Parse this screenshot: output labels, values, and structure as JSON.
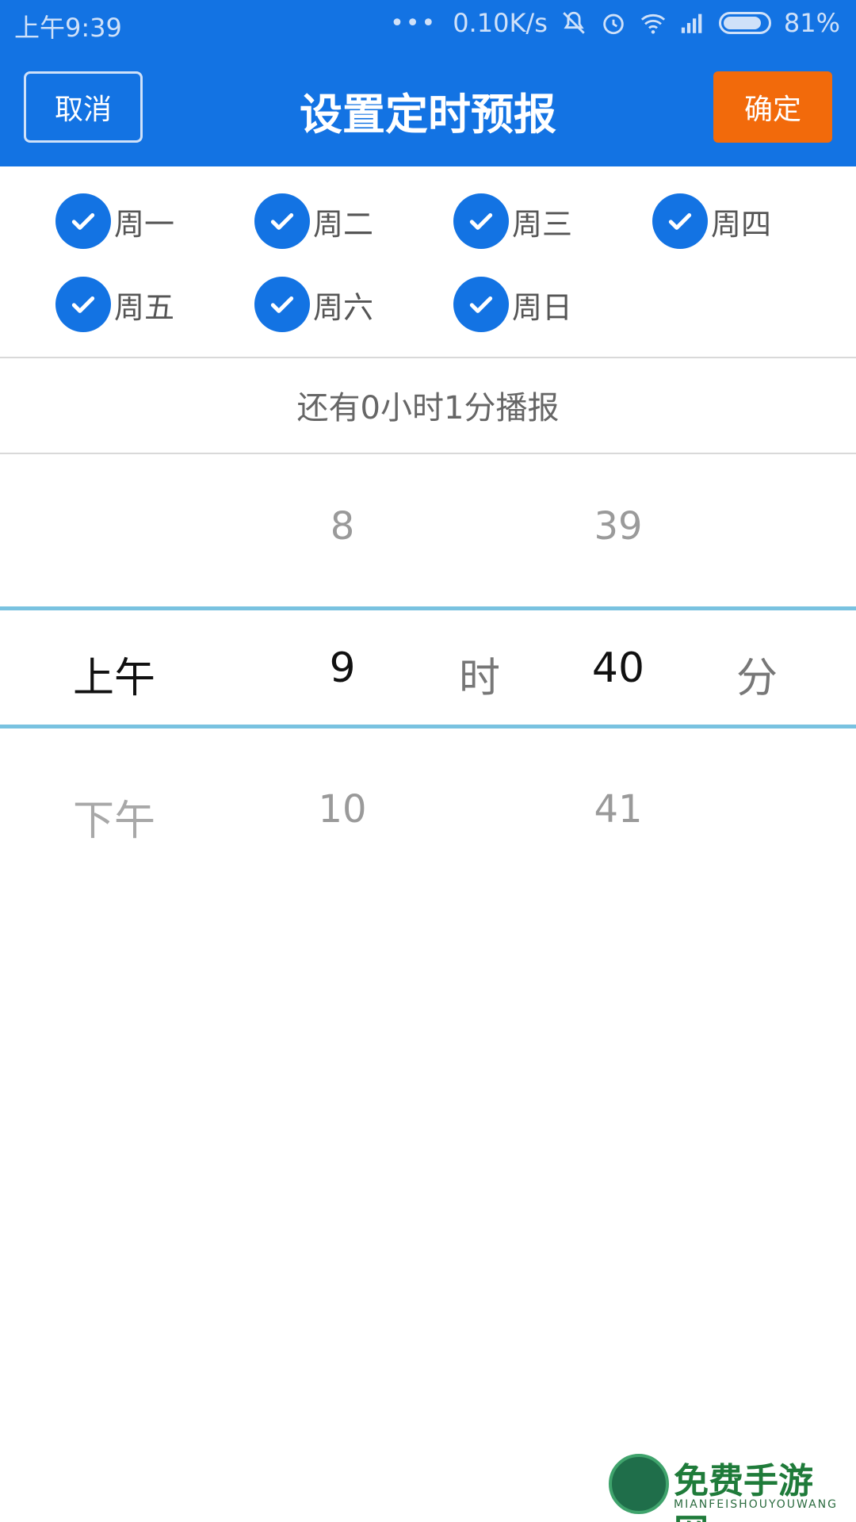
{
  "status_bar": {
    "time": "上午9:39",
    "network_speed": "0.10K/s",
    "battery": "81%",
    "battery_level": 0.81,
    "icons": [
      "more-dots-icon",
      "mute-icon",
      "alarm-icon",
      "wifi-icon",
      "signal-icon",
      "battery-icon"
    ]
  },
  "header": {
    "cancel_label": "取消",
    "title": "设置定时预报",
    "confirm_label": "确定"
  },
  "weekdays": [
    {
      "label": "周一",
      "checked": true
    },
    {
      "label": "周二",
      "checked": true
    },
    {
      "label": "周三",
      "checked": true
    },
    {
      "label": "周四",
      "checked": true
    },
    {
      "label": "周五",
      "checked": true
    },
    {
      "label": "周六",
      "checked": true
    },
    {
      "label": "周日",
      "checked": true
    }
  ],
  "countdown": "还有0小时1分播报",
  "picker": {
    "period": {
      "selected": "上午",
      "next": "下午"
    },
    "hour": {
      "prev": "8",
      "selected": "9",
      "next": "10",
      "unit": "时"
    },
    "minute": {
      "prev": "39",
      "selected": "40",
      "next": "41",
      "unit": "分"
    }
  },
  "watermark": {
    "text": "免费手游网",
    "subtext": "MIANFEISHOUYOUWANG"
  },
  "colors": {
    "primary": "#1373e3",
    "confirm": "#f26a0b",
    "picker_line": "#79c2e0"
  }
}
